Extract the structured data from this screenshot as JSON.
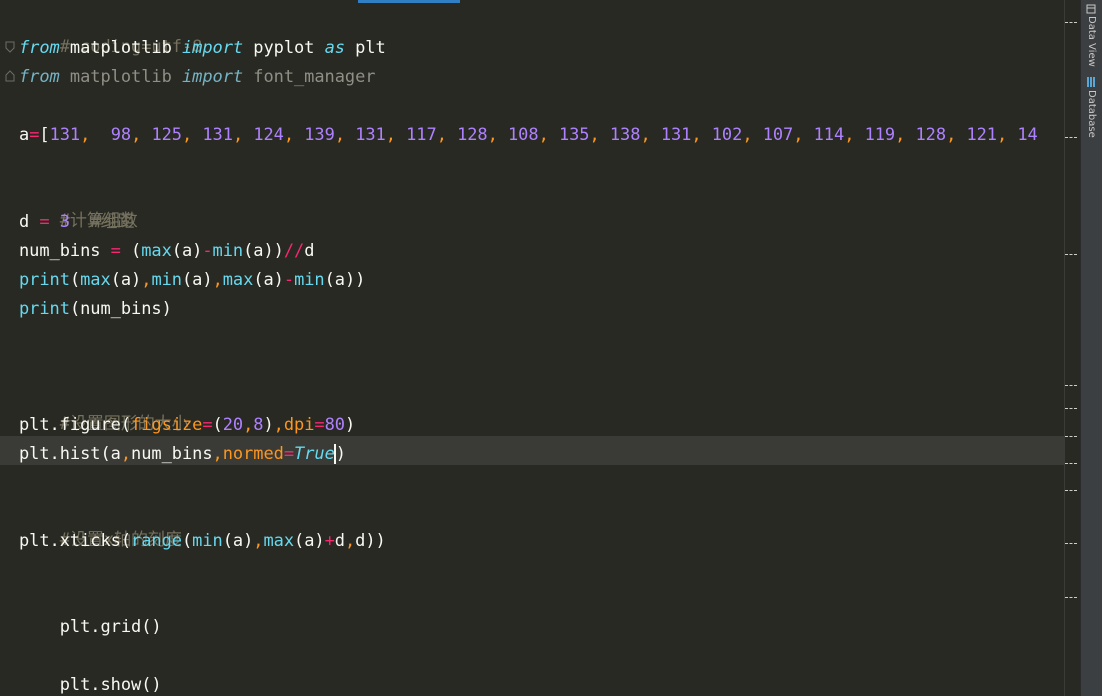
{
  "editor": {
    "lines": {
      "coding": "# coding=utf-8",
      "import1": {
        "from": "from",
        "mod": " matplotlib ",
        "imp": "import",
        "name": " pyplot ",
        "as": "as",
        "alias": " plt"
      },
      "import2": {
        "from": "from",
        "mod": " matplotlib ",
        "imp": "import",
        "name": " font_manager"
      },
      "a_line": {
        "var": "a",
        "eq": "=",
        "open": "[",
        "values": [
          "131",
          "98",
          "125",
          "131",
          "124",
          "139",
          "131",
          "117",
          "128",
          "108",
          "135",
          "138",
          "131",
          "102",
          "107",
          "114",
          "119",
          "128",
          "121",
          "14"
        ]
      },
      "comment_calc": "#计算组数",
      "d_line": {
        "var": "d ",
        "eq": "=",
        "val": " 3",
        "comment": "  #组距"
      },
      "numbins_line": {
        "var": "num_bins ",
        "eq": "=",
        "p1": " (",
        "f1": "max",
        "a1": "(a)",
        "m": "-",
        "f2": "min",
        "a2": "(a))",
        "op": "//",
        "rest": "d"
      },
      "print1": {
        "fn": "print",
        "p": "(",
        "f1": "max",
        "a1": "(a)",
        "c1": ",",
        "f2": "min",
        "a2": "(a)",
        "c2": ",",
        "f3": "max",
        "a3": "(a)",
        "m": "-",
        "f4": "min",
        "a4": "(a))"
      },
      "print2": {
        "fn": "print",
        "rest": "(num_bins)"
      },
      "comment_size": "#设置图形的大小",
      "figure_line": {
        "pre": "plt.figure(",
        "k1": "figsize",
        "e1": "=",
        "p": "(",
        "n1": "20",
        "c": ",",
        "n2": "8",
        "cl": ")",
        "c2": ",",
        "k2": "dpi",
        "e2": "=",
        "n3": "80",
        "end": ")"
      },
      "hist_line": {
        "pre": "plt.hist(a",
        "c1": ",",
        "mid": "num_bins",
        "c2": ",",
        "k": "normed",
        "e": "=",
        "val": "True",
        "end": ")"
      },
      "comment_xticks": "#设置x轴的刻度",
      "xticks_line": {
        "pre": "plt.xticks(",
        "f1": "range",
        "p": "(",
        "f2": "min",
        "a1": "(a)",
        "c": ",",
        "f3": "max",
        "a2": "(a)",
        "plus": "+",
        "d": "d",
        "c2": ",",
        "end": "d))"
      },
      "grid_line": "plt.grid()",
      "show_line": "plt.show()"
    }
  },
  "right_panel": {
    "tabs": [
      {
        "label": "Data View",
        "icon": "data-view-icon"
      },
      {
        "label": "Database",
        "icon": "database-icon"
      }
    ]
  },
  "colors": {
    "background": "#282923",
    "current_line": "#3a3a36",
    "keyword": "#66d9ef",
    "number": "#ae81ff",
    "operator": "#f92672",
    "parameter": "#fd971f",
    "comment": "#75715e"
  }
}
